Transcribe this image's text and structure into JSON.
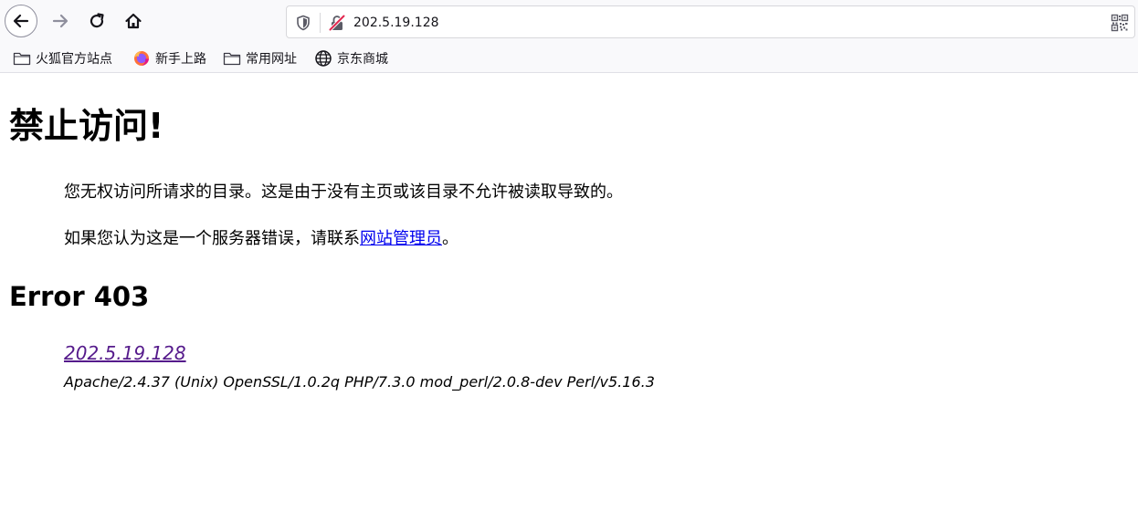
{
  "browser": {
    "toolbar": {
      "back_icon": "arrow-left-icon",
      "forward_icon": "arrow-right-icon",
      "reload_icon": "reload-icon",
      "home_icon": "home-icon"
    },
    "urlbar": {
      "url": "202.5.19.128",
      "security_icon": "shield-icon",
      "connection_icon": "insecure-lock-icon",
      "qr_icon": "qr-code-icon"
    },
    "bookmarks": [
      {
        "label": "火狐官方站点",
        "icon": "folder-icon"
      },
      {
        "label": "新手上路",
        "icon": "firefox-icon"
      },
      {
        "label": "常用网址",
        "icon": "folder-icon"
      },
      {
        "label": "京东商城",
        "icon": "globe-icon"
      }
    ]
  },
  "page": {
    "title": "禁止访问!",
    "paragraph1": "您无权访问所请求的目录。这是由于没有主页或该目录不允许被读取导致的。",
    "paragraph2_prefix": "如果您认为这是一个服务器错误，请联系",
    "paragraph2_link": "网站管理员",
    "paragraph2_suffix": "。",
    "error_heading": "Error 403",
    "address_link": "202.5.19.128",
    "server_signature": "Apache/2.4.37 (Unix) OpenSSL/1.0.2q PHP/7.3.0 mod_perl/2.0.8-dev Perl/v5.16.3"
  },
  "colors": {
    "chrome_bg": "#f9f9fb",
    "link": "#0000ee",
    "visited_link": "#551a8b",
    "insecure_accent": "#e22850"
  }
}
